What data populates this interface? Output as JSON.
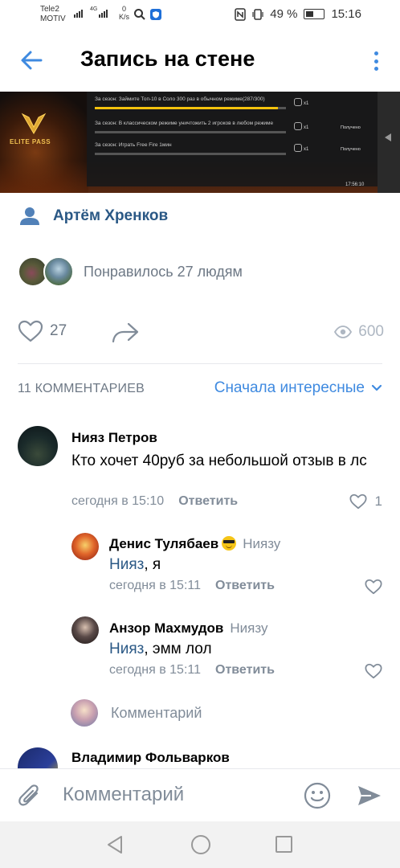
{
  "status_bar": {
    "carrier_line1": "Tele2",
    "carrier_line2": "MOTIV",
    "network_type": "4G",
    "data_rate_value": "0",
    "data_rate_unit": "K/s",
    "battery": "49 %",
    "time": "15:16"
  },
  "header": {
    "title": "Запись на стене"
  },
  "banner": {
    "logo_text": "ELITE PASS",
    "missions": [
      {
        "text": "За сезон: Займите Топ-10 в Соло 300 раз в обычном режиме(287/300)",
        "progress": 0.96,
        "reward": "x1",
        "status": ""
      },
      {
        "text": "За сезон: В классическом режиме уничтожить 2 игроков в любом режиме",
        "progress": 1.0,
        "reward": "x1",
        "status": "Получено"
      },
      {
        "text": "За сезон: Играть Free Fire 1мин",
        "progress": 1.0,
        "reward": "x1",
        "status": "Получено"
      }
    ],
    "timer": "17:56:10"
  },
  "author": {
    "name": "Артём Хренков"
  },
  "likes": {
    "text": "Понравилось 27 людям"
  },
  "actions": {
    "like_count": "27",
    "views": "600"
  },
  "comments_header": {
    "count_label": "11 КОММЕНТАРИЕВ",
    "sort_label": "Сначала интересные"
  },
  "comments": [
    {
      "author": "Нияз Петров",
      "text": "Кто хочет 40руб за небольшой отзыв в лс",
      "time": "сегодня в 15:10",
      "reply_label": "Ответить",
      "likes": "1"
    },
    {
      "author": "Денис Тулябаев",
      "reply_to": "Ниязу",
      "mention": "Нияз",
      "text": ", я",
      "time": "сегодня в 15:11",
      "reply_label": "Ответить"
    },
    {
      "author": "Анзор Махмудов",
      "reply_to": "Ниязу",
      "mention": "Нияз",
      "text": ", эмм лол",
      "time": "сегодня в 15:11",
      "reply_label": "Ответить"
    },
    {
      "author": "Владимир Фольварков"
    }
  ],
  "reply_composer": {
    "placeholder": "Комментарий"
  },
  "input_bar": {
    "placeholder": "Комментарий"
  },
  "colors": {
    "accent": "#3f8ae0",
    "link": "#2a5885",
    "secondary_text": "#818c99"
  }
}
